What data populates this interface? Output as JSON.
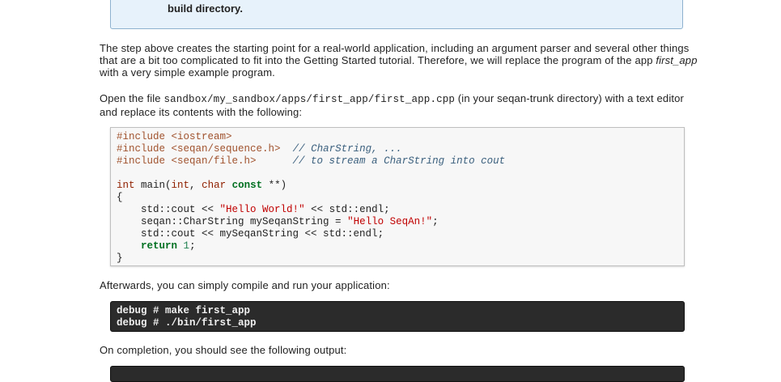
{
  "note": {
    "text": "build directory."
  },
  "para1": "The step above creates the starting point for a real-world application, including an argument parser and several other things that are a bit too complicated to fit into the Getting Started tutorial. Therefore, we will replace the program of the app ",
  "para1_em": "first_app",
  "para1_end": " with a very simple example program.",
  "para2_start": "Open the file ",
  "para2_path": "sandbox/my_sandbox/apps/first_app/first_app.cpp",
  "para2_mid": " (in your seqan-trunk directory) with a text editor and replace its contents with the following:",
  "code": {
    "l1_pp": "#include <iostream>",
    "l2_pp": "#include <seqan/sequence.h>",
    "l2_cm": "// CharString, ...",
    "l3_pp": "#include <seqan/file.h>",
    "l3_cm": "// to stream a CharString into cout",
    "main_int": "int",
    "main_name": " main(",
    "main_int2": "int",
    "main_char": "char",
    "main_const": "const",
    "main_rest": " **)",
    "brace_open": "{",
    "s1a": "std::cout << ",
    "s1_str": "\"Hello World!\"",
    "s1b": " << std::endl;",
    "s2a": "seqan::CharString mySeqanString = ",
    "s2_str": "\"Hello SeqAn!\"",
    "s2b": ";",
    "s3": "std::cout << mySeqanString << std::endl;",
    "ret_kw": "return",
    "ret_num": "1",
    "ret_end": ";",
    "brace_close": "}"
  },
  "para3": "Afterwards, you can simply compile and run your application:",
  "terminal": {
    "line1": "debug # make first_app",
    "line2": "debug # ./bin/first_app"
  },
  "para4": "On completion, you should see the following output:"
}
